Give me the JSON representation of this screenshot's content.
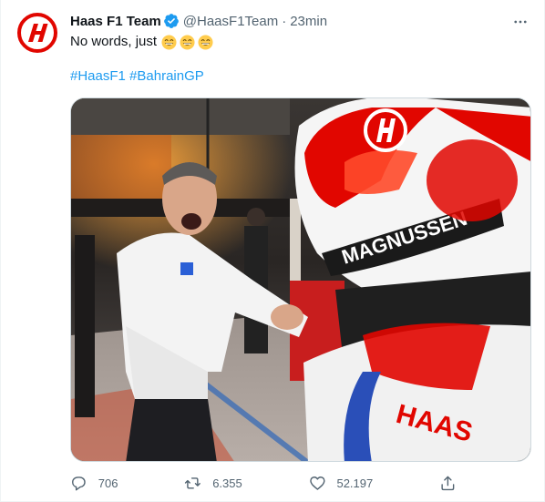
{
  "tweet": {
    "author_name": "Haas F1 Team",
    "handle": "@HaasF1Team",
    "separator": "·",
    "time": "23min",
    "text": "No words, just",
    "emojis": [
      "grinning-face-with-smiling-eyes",
      "grinning-face-with-smiling-eyes",
      "grinning-face-with-smiling-eyes"
    ],
    "hashtags": [
      "#HaasF1",
      "#BahrainGP"
    ],
    "media_helmet_text": "MAGNUSSEN",
    "media_suit_text": "HAAS"
  },
  "actions": {
    "replies": "706",
    "retweets": "6.355",
    "likes": "52.197"
  },
  "colors": {
    "accent": "#1d9bf0",
    "haas_red": "#e10600",
    "muted": "#536471"
  },
  "icons": {
    "verified": "verified-badge-icon",
    "more": "more-dots-icon",
    "reply": "reply-icon",
    "retweet": "retweet-icon",
    "like": "heart-icon",
    "share": "share-icon"
  }
}
